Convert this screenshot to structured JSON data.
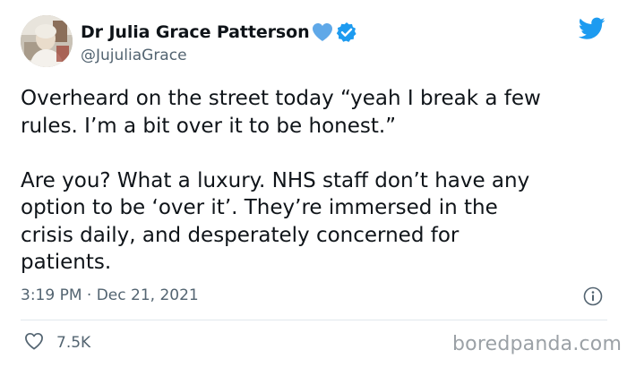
{
  "author": {
    "display_name": "Dr Julia Grace Patterson",
    "handle": "@JujuliaGrace",
    "name_emoji_icon": "blue-heart-icon",
    "verified_icon": "verified-badge-icon"
  },
  "tweet": {
    "text": "Overheard on the street today “yeah I break a few\nrules. I’m a bit over it to be honest.”\n\nAre you? What a luxury. NHS staff don’t have any\noption to be ‘over it’. They’re immersed in the\ncrisis daily, and desperately concerned for\npatients.",
    "timestamp": "3:19 PM · Dec 21, 2021",
    "likes": "7.5K"
  },
  "watermark": "boredpanda.com",
  "colors": {
    "brand_blue": "#1d9bf0",
    "secondary_text": "#536471",
    "heart_blue": "#5fa8e8"
  }
}
